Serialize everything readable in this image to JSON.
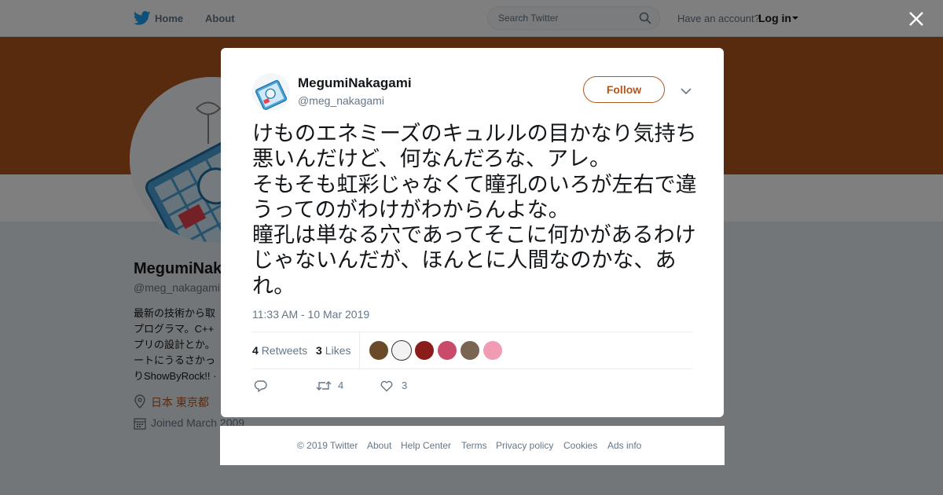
{
  "topbar": {
    "home_label": "Home",
    "about_label": "About",
    "search_placeholder": "Search Twitter",
    "account_question": "Have an account?",
    "login_label": "Log in"
  },
  "profile": {
    "name": "MegumiNakagami",
    "handle": "@meg_nakagami",
    "bio_lines": [
      "最新の技術から取",
      "プログラマ。C++",
      "プリの設計とか。",
      "ートにうるさかっ",
      "りShowByRock!! ·"
    ],
    "location": "日本 東京都",
    "joined": "Joined March 2009"
  },
  "tweet": {
    "author_name": "MegumiNakagami",
    "author_handle": "@meg_nakagami",
    "follow_label": "Follow",
    "text": "けものエネミーズのキュルルの目かなり気持ち悪いんだけど、何なんだろな、アレ。\nそもそも虹彩じゃなくて瞳孔のいろが左右で違うってのがわけがわからんよな。\n瞳孔は単なる穴であってそこに何かがあるわけじゃないんだが、ほんとに人間なのかな、あれ。",
    "time": "11:33 AM - 10 Mar 2019",
    "retweets_count": "4",
    "retweets_label": "Retweets",
    "likes_count": "3",
    "likes_label": "Likes",
    "action_retweet_count": "4",
    "action_like_count": "3"
  },
  "likers": [
    {
      "icon": "liker-avatar",
      "color": "#6b4a2a"
    },
    {
      "icon": "liker-avatar",
      "color": "#f2f2f2"
    },
    {
      "icon": "liker-avatar",
      "color": "#8a1c1c"
    },
    {
      "icon": "liker-avatar",
      "color": "#c94a6a"
    },
    {
      "icon": "liker-avatar",
      "color": "#7a6552"
    },
    {
      "icon": "liker-avatar",
      "color": "#f19bb5"
    }
  ],
  "footer": {
    "copyright": "© 2019 Twitter",
    "about": "About",
    "help": "Help Center",
    "terms": "Terms",
    "privacy": "Privacy policy",
    "cookies": "Cookies",
    "ads": "Ads info"
  },
  "colors": {
    "profile_accent": "#b0561f",
    "twitter_blue": "#1da1f2",
    "muted_text": "#657786"
  }
}
